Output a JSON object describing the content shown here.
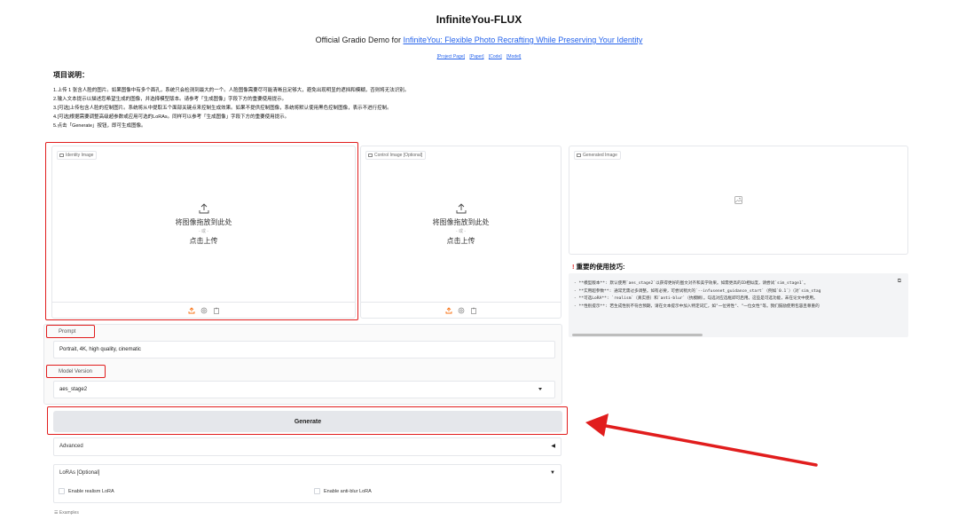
{
  "header": {
    "title": "InfiniteYou-FLUX",
    "subtitle_prefix": "Official Gradio Demo for ",
    "subtitle_link": "InfiniteYou: Flexible Photo Recrafting While Preserving Your Identity",
    "links": [
      "[Project Page]",
      "[Paper]",
      "[Code]",
      "[Model]"
    ]
  },
  "description": {
    "title": "项目说明：",
    "steps": [
      "1.上传 1 张含人脸的图片。如果图像中有多个面孔，系统只会检测到最大的一个。人脸图像需要尽可能清晰且足够大，避免出现明显的遮挡和模糊，否则将无法识别。",
      "2.输入文本提示以描述您希望生成的图像，并选择模型版本。请参考「生成图像」字段下方的重要使用提示。",
      "3.[可选]上传包含人脸的控制图片。系统将从中提取五个面部关键点来控制生成效果。如果不提供控制图像，系统将默认使用黑色控制图像，表示不进行控制。",
      "4.[可选]根据需要调整高级超参数或应用可选的LoRAs。同样可以参考「生成图像」字段下方的重要使用提示。",
      "5.点击「Generate」按钮，即可生成图像。"
    ]
  },
  "identity_panel": {
    "label": "Identity Image",
    "drop_text": "将图像拖放到此处",
    "or_text": "- 或 -",
    "click_text": "点击上传"
  },
  "control_panel": {
    "label": "Control Image [Optional]",
    "drop_text": "将图像拖放到此处",
    "or_text": "- 或 -",
    "click_text": "点击上传"
  },
  "generated_panel": {
    "label": "Generated Image"
  },
  "tips": {
    "title": "重要的使用技巧:",
    "items": [
      "- **模型版本**: 默认使用`aes_stage2`以获得更好的图文对齐和美学效果。如需更高的ID相似度，请尝试`sim_stage1`。",
      "- **实用超参数**: 通常无需过多调整。如有必要，可尝试稍大的`--infusenet_guidance_start`（例如`0.1`）（对`sim_stag",
      "- **可选LoRA**: `realism`（真实感）和`anti-blur`（抗模糊）。勾选对应选框即可启用。这些是可选功能，未在论文中使用。",
      "- **性别提示**: 若生成性别不符合预期，请在文本提示中加入特定词汇，如\"一位男性\"、\"一位女性\"等。我们鼓励使用包容且尊重的"
    ]
  },
  "form": {
    "prompt_label": "Prompt",
    "prompt_value": "Portrait, 4K, high quality, cinematic",
    "model_label": "Model Version",
    "model_value": "aes_stage2",
    "generate_label": "Generate",
    "advanced_label": "Advanced",
    "loras_label": "LoRAs [Optional]",
    "realism_label": "Enable realism LoRA",
    "antiblur_label": "Enable anti-blur LoRA",
    "examples_label": "Examples"
  },
  "colors": {
    "annotation_red": "#e11d1d",
    "link_blue": "#2563eb",
    "upload_orange": "#f97316"
  }
}
